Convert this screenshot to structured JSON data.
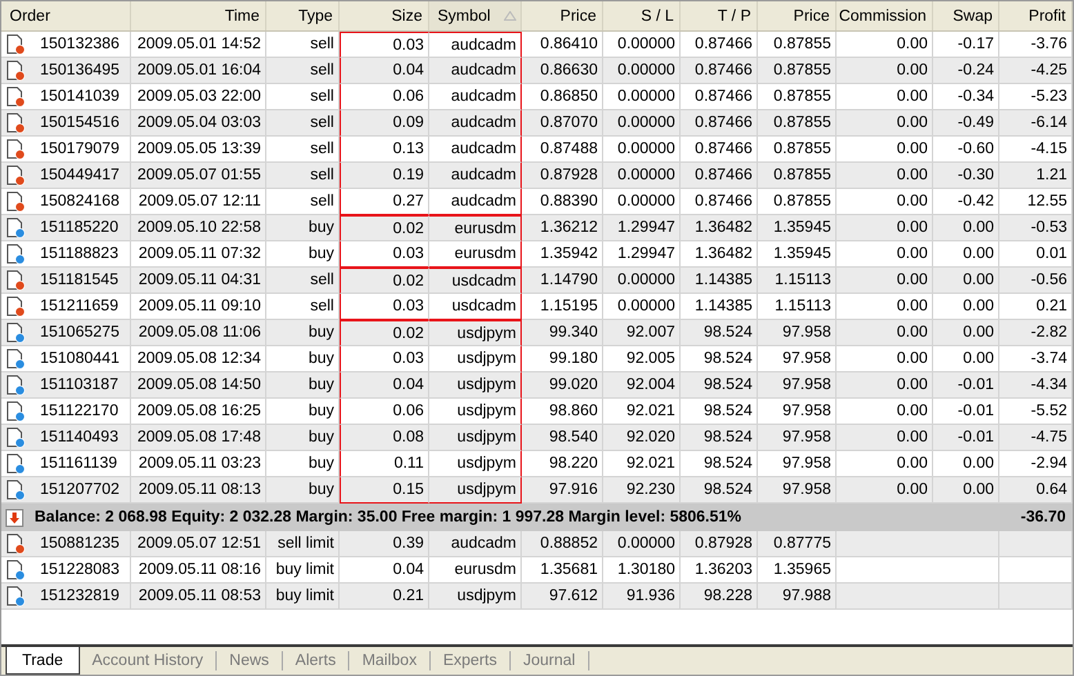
{
  "columns": [
    {
      "label": "Order",
      "sorted": false
    },
    {
      "label": "Time",
      "sorted": false
    },
    {
      "label": "Type",
      "sorted": false
    },
    {
      "label": "Size",
      "sorted": false
    },
    {
      "label": "Symbol",
      "sorted": true
    },
    {
      "label": "Price",
      "sorted": false
    },
    {
      "label": "S / L",
      "sorted": false
    },
    {
      "label": "T / P",
      "sorted": false
    },
    {
      "label": "Price",
      "sorted": false
    },
    {
      "label": "Commission",
      "sorted": false
    },
    {
      "label": "Swap",
      "sorted": false
    },
    {
      "label": "Profit",
      "sorted": false
    }
  ],
  "open_groups": [
    {
      "highlighted": true,
      "rows": [
        {
          "kind": "sell",
          "cells": [
            "150132386",
            "2009.05.01 14:52",
            "sell",
            "0.03",
            "audcadm",
            "0.86410",
            "0.00000",
            "0.87466",
            "0.87855",
            "0.00",
            "-0.17",
            "-3.76"
          ]
        },
        {
          "kind": "sell",
          "cells": [
            "150136495",
            "2009.05.01 16:04",
            "sell",
            "0.04",
            "audcadm",
            "0.86630",
            "0.00000",
            "0.87466",
            "0.87855",
            "0.00",
            "-0.24",
            "-4.25"
          ]
        },
        {
          "kind": "sell",
          "cells": [
            "150141039",
            "2009.05.03 22:00",
            "sell",
            "0.06",
            "audcadm",
            "0.86850",
            "0.00000",
            "0.87466",
            "0.87855",
            "0.00",
            "-0.34",
            "-5.23"
          ]
        },
        {
          "kind": "sell",
          "cells": [
            "150154516",
            "2009.05.04 03:03",
            "sell",
            "0.09",
            "audcadm",
            "0.87070",
            "0.00000",
            "0.87466",
            "0.87855",
            "0.00",
            "-0.49",
            "-6.14"
          ]
        },
        {
          "kind": "sell",
          "cells": [
            "150179079",
            "2009.05.05 13:39",
            "sell",
            "0.13",
            "audcadm",
            "0.87488",
            "0.00000",
            "0.87466",
            "0.87855",
            "0.00",
            "-0.60",
            "-4.15"
          ]
        },
        {
          "kind": "sell",
          "cells": [
            "150449417",
            "2009.05.07 01:55",
            "sell",
            "0.19",
            "audcadm",
            "0.87928",
            "0.00000",
            "0.87466",
            "0.87855",
            "0.00",
            "-0.30",
            "1.21"
          ]
        },
        {
          "kind": "sell",
          "cells": [
            "150824168",
            "2009.05.07 12:11",
            "sell",
            "0.27",
            "audcadm",
            "0.88390",
            "0.00000",
            "0.87466",
            "0.87855",
            "0.00",
            "-0.42",
            "12.55"
          ]
        }
      ]
    },
    {
      "highlighted": true,
      "rows": [
        {
          "kind": "buy",
          "cells": [
            "151185220",
            "2009.05.10 22:58",
            "buy",
            "0.02",
            "eurusdm",
            "1.36212",
            "1.29947",
            "1.36482",
            "1.35945",
            "0.00",
            "0.00",
            "-0.53"
          ]
        },
        {
          "kind": "buy",
          "cells": [
            "151188823",
            "2009.05.11 07:32",
            "buy",
            "0.03",
            "eurusdm",
            "1.35942",
            "1.29947",
            "1.36482",
            "1.35945",
            "0.00",
            "0.00",
            "0.01"
          ]
        }
      ]
    },
    {
      "highlighted": true,
      "rows": [
        {
          "kind": "sell",
          "cells": [
            "151181545",
            "2009.05.11 04:31",
            "sell",
            "0.02",
            "usdcadm",
            "1.14790",
            "0.00000",
            "1.14385",
            "1.15113",
            "0.00",
            "0.00",
            "-0.56"
          ]
        },
        {
          "kind": "sell",
          "cells": [
            "151211659",
            "2009.05.11 09:10",
            "sell",
            "0.03",
            "usdcadm",
            "1.15195",
            "0.00000",
            "1.14385",
            "1.15113",
            "0.00",
            "0.00",
            "0.21"
          ]
        }
      ]
    },
    {
      "highlighted": true,
      "rows": [
        {
          "kind": "buy",
          "cells": [
            "151065275",
            "2009.05.08 11:06",
            "buy",
            "0.02",
            "usdjpym",
            "99.340",
            "92.007",
            "98.524",
            "97.958",
            "0.00",
            "0.00",
            "-2.82"
          ]
        },
        {
          "kind": "buy",
          "cells": [
            "151080441",
            "2009.05.08 12:34",
            "buy",
            "0.03",
            "usdjpym",
            "99.180",
            "92.005",
            "98.524",
            "97.958",
            "0.00",
            "0.00",
            "-3.74"
          ]
        },
        {
          "kind": "buy",
          "cells": [
            "151103187",
            "2009.05.08 14:50",
            "buy",
            "0.04",
            "usdjpym",
            "99.020",
            "92.004",
            "98.524",
            "97.958",
            "0.00",
            "-0.01",
            "-4.34"
          ]
        },
        {
          "kind": "buy",
          "cells": [
            "151122170",
            "2009.05.08 16:25",
            "buy",
            "0.06",
            "usdjpym",
            "98.860",
            "92.021",
            "98.524",
            "97.958",
            "0.00",
            "-0.01",
            "-5.52"
          ]
        },
        {
          "kind": "buy",
          "cells": [
            "151140493",
            "2009.05.08 17:48",
            "buy",
            "0.08",
            "usdjpym",
            "98.540",
            "92.020",
            "98.524",
            "97.958",
            "0.00",
            "-0.01",
            "-4.75"
          ]
        },
        {
          "kind": "buy",
          "cells": [
            "151161139",
            "2009.05.11 03:23",
            "buy",
            "0.11",
            "usdjpym",
            "98.220",
            "92.021",
            "98.524",
            "97.958",
            "0.00",
            "0.00",
            "-2.94"
          ]
        },
        {
          "kind": "buy",
          "cells": [
            "151207702",
            "2009.05.11 08:13",
            "buy",
            "0.15",
            "usdjpym",
            "97.916",
            "92.230",
            "98.524",
            "97.958",
            "0.00",
            "0.00",
            "0.64"
          ]
        }
      ]
    }
  ],
  "summary": {
    "text": "Balance: 2 068.98  Equity: 2 032.28  Margin: 35.00  Free margin: 1 997.28  Margin level: 5806.51%",
    "profit": "-36.70"
  },
  "pending_rows": [
    {
      "kind": "sell",
      "cells": [
        "150881235",
        "2009.05.07 12:51",
        "sell limit",
        "0.39",
        "audcadm",
        "0.88852",
        "0.00000",
        "0.87928",
        "0.87775"
      ]
    },
    {
      "kind": "buy",
      "cells": [
        "151228083",
        "2009.05.11 08:16",
        "buy limit",
        "0.04",
        "eurusdm",
        "1.35681",
        "1.30180",
        "1.36203",
        "1.35965"
      ]
    },
    {
      "kind": "buy",
      "cells": [
        "151232819",
        "2009.05.11 08:53",
        "buy limit",
        "0.21",
        "usdjpym",
        "97.612",
        "91.936",
        "98.228",
        "97.988"
      ]
    }
  ],
  "tabs": [
    {
      "label": "Trade",
      "selected": true
    },
    {
      "label": "Account History",
      "selected": false
    },
    {
      "label": "News",
      "selected": false
    },
    {
      "label": "Alerts",
      "selected": false
    },
    {
      "label": "Mailbox",
      "selected": false
    },
    {
      "label": "Experts",
      "selected": false
    },
    {
      "label": "Journal",
      "selected": false
    }
  ]
}
